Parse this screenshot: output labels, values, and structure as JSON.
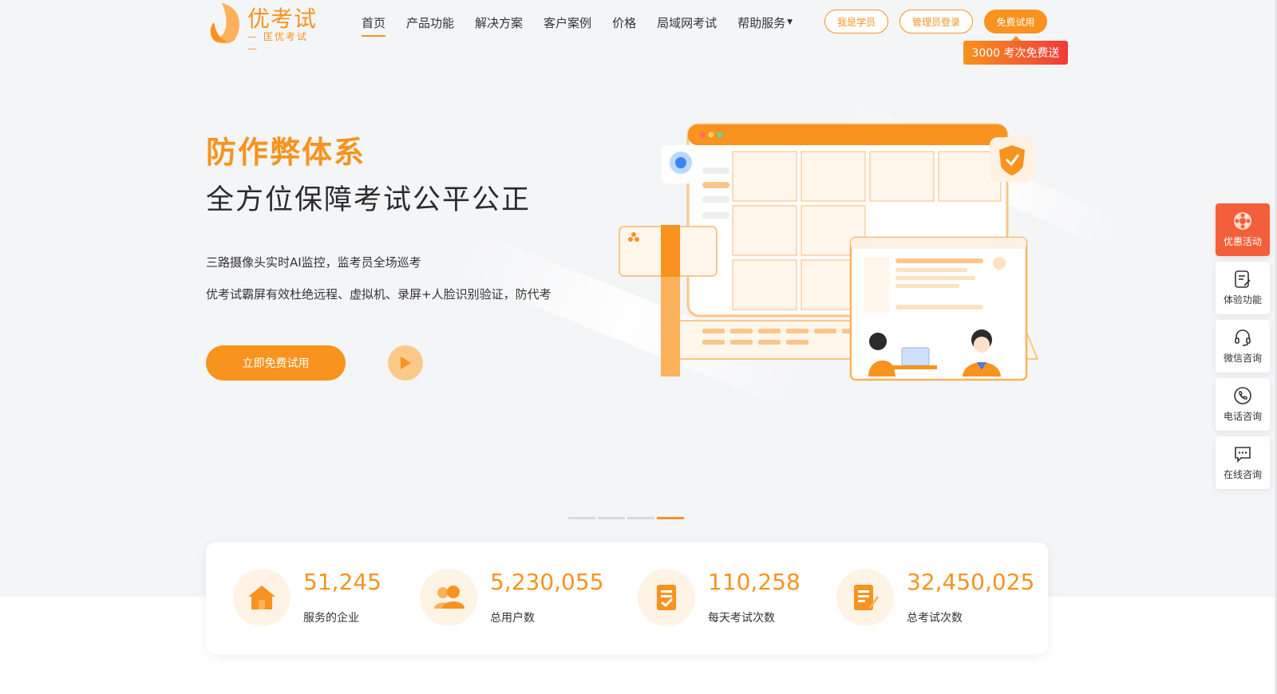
{
  "brand": {
    "name": "优考试",
    "tagline": "— 匡优考试 —",
    "color": "#f7931e"
  },
  "nav": {
    "items": [
      {
        "label": "首页",
        "active": true
      },
      {
        "label": "产品功能"
      },
      {
        "label": "解决方案"
      },
      {
        "label": "客户案例"
      },
      {
        "label": "价格"
      },
      {
        "label": "局域网考试"
      },
      {
        "label": "帮助服务",
        "dropdown": true
      }
    ],
    "student_button": "我是学员",
    "admin_button": "管理员登录",
    "trial_button": "免费试用",
    "promo_badge": "3000 考次免费送"
  },
  "hero": {
    "title": "防作弊体系",
    "subtitle": "全方位保障考试公平公正",
    "line1": "三路摄像头实时AI监控，监考员全场巡考",
    "line2": "优考试霸屏有效杜绝远程、虚拟机、录屏+人脸识别验证，防代考",
    "cta": "立即免费试用",
    "carousel_slides": 4,
    "carousel_active": 4
  },
  "stats": [
    {
      "value": "51,245",
      "label": "服务的企业",
      "icon": "house-icon"
    },
    {
      "value": "5,230,055",
      "label": "总用户数",
      "icon": "users-icon"
    },
    {
      "value": "110,258",
      "label": "每天考试次数",
      "icon": "exam-doc-icon"
    },
    {
      "value": "32,450,025",
      "label": "总考试次数",
      "icon": "edit-doc-icon"
    }
  ],
  "sidebar": [
    {
      "label": "优惠活动",
      "icon": "gift-wheel-icon",
      "active": true
    },
    {
      "label": "体验功能",
      "icon": "edit-note-icon"
    },
    {
      "label": "微信咨询",
      "icon": "headset-icon"
    },
    {
      "label": "电话咨询",
      "icon": "phone-icon"
    },
    {
      "label": "在线咨询",
      "icon": "chat-icon"
    }
  ],
  "colors": {
    "accent": "#f7931e",
    "promo_gradient_end": "#ef3a3a",
    "sidebar_active": "#f25f3a",
    "hero_bg": "#f4f5f7"
  }
}
